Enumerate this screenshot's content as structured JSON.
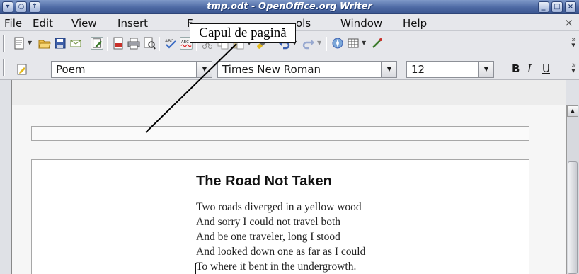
{
  "window": {
    "title": "tmp.odt - OpenOffice.org Writer",
    "left_controls": [
      "▾",
      "○",
      "↑"
    ],
    "right_controls": [
      "_",
      "□",
      "×"
    ]
  },
  "menu": {
    "items": [
      {
        "underlined": "F",
        "rest": "ile"
      },
      {
        "underlined": "E",
        "rest": "dit"
      },
      {
        "underlined": "V",
        "rest": "iew"
      },
      {
        "underlined": "I",
        "rest": "nsert"
      },
      {
        "underlined": "F",
        "rest": ""
      },
      {
        "underlined": "",
        "rest": "ols"
      },
      {
        "underlined": "W",
        "rest": "indow"
      },
      {
        "underlined": "H",
        "rest": "elp"
      }
    ],
    "close": "×"
  },
  "toolbar": {
    "icons": [
      "document-icon",
      "open-folder-icon",
      "save-icon",
      "email-icon",
      "edit-mode-icon",
      "export-pdf-icon",
      "print-icon",
      "page-preview-icon",
      "spellcheck-icon",
      "autospellcheck-icon",
      "cut-icon",
      "copy-icon",
      "paste-icon",
      "format-paintbrush-icon",
      "undo-icon",
      "redo-icon",
      "navigator-icon",
      "table-icon",
      "draw-functions-icon"
    ],
    "more": "»"
  },
  "formatting": {
    "paragraph_style": "Poem",
    "font_name": "Times New Roman",
    "font_size": "12",
    "bold": "B",
    "italic": "I",
    "underline": "U",
    "more": "»"
  },
  "annotation": {
    "label": "Capul de pagină"
  },
  "document": {
    "poem_title": "The Road Not Taken",
    "lines": [
      "Two roads diverged in a yellow wood",
      "And sorry I could not travel both",
      "And be one traveler, long I stood",
      "And looked down one as far as I could",
      "To where it bent in the undergrowth."
    ]
  },
  "colors": {
    "titlebar": "#4e6aa4",
    "chrome": "#e6e7eb",
    "page": "#ffffff"
  }
}
